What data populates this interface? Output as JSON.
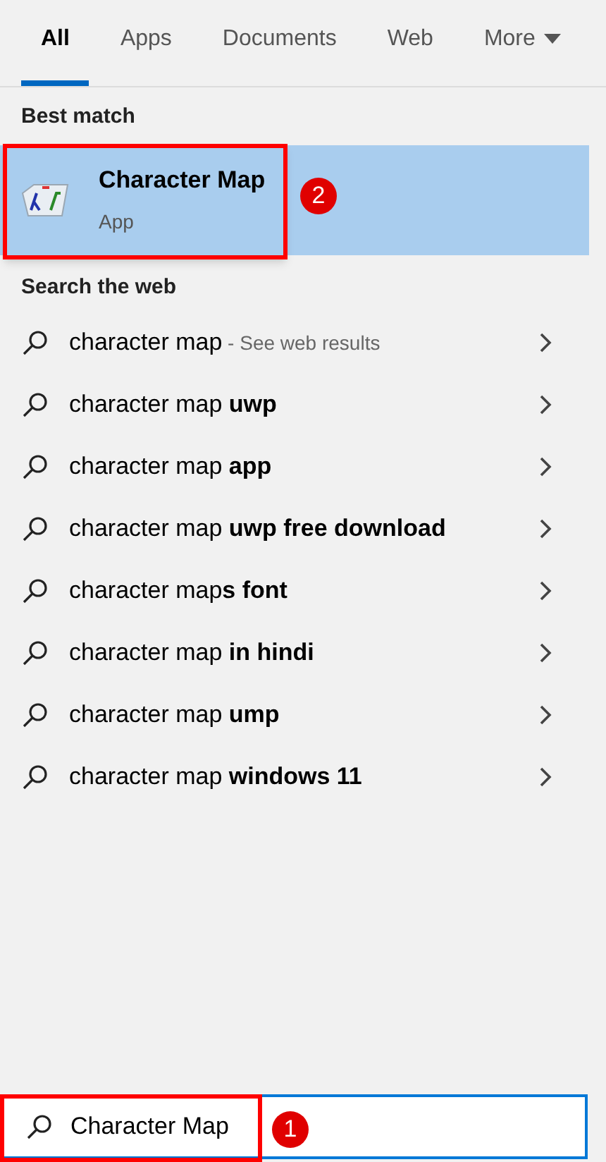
{
  "tabs": [
    {
      "label": "All",
      "selected": true
    },
    {
      "label": "Apps",
      "selected": false
    },
    {
      "label": "Documents",
      "selected": false
    },
    {
      "label": "Web",
      "selected": false
    },
    {
      "label": "More",
      "selected": false,
      "dropdown": true
    }
  ],
  "best_match": {
    "heading": "Best match",
    "title": "Character Map",
    "subtitle": "App",
    "selected": true,
    "badge": "2"
  },
  "web": {
    "heading": "Search the web",
    "suggestions": [
      {
        "text": "character map",
        "hint": " - See web results"
      },
      {
        "text": "character map **uwp**"
      },
      {
        "text": "character map **app**"
      },
      {
        "text": "character map **uwp free download**"
      },
      {
        "text": "character map**s font**"
      },
      {
        "text": "character map **in hindi**"
      },
      {
        "text": "character map **ump**"
      },
      {
        "text": "character map **windows 11**"
      }
    ]
  },
  "search": {
    "value": "Character Map",
    "badge": "1"
  }
}
